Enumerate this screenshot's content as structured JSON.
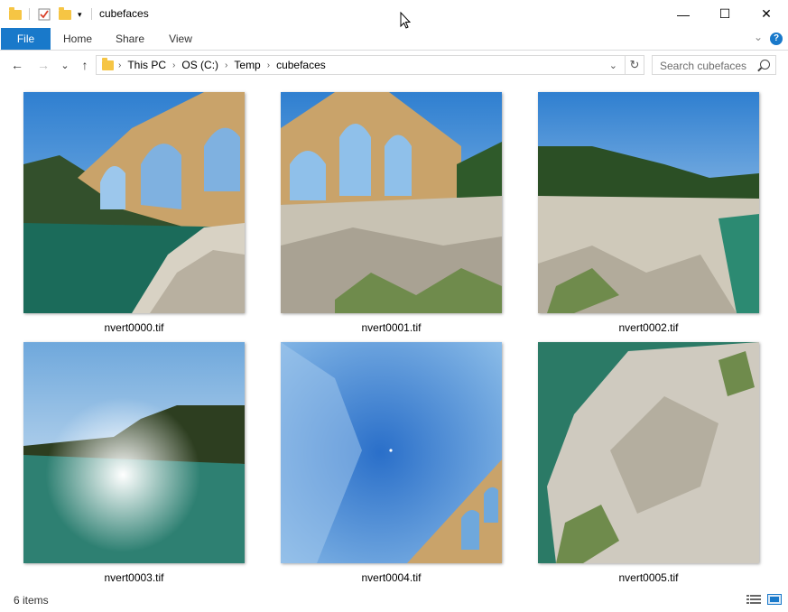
{
  "window": {
    "title": "cubefaces",
    "minimize": "—",
    "maximize": "☐",
    "close": "✕"
  },
  "ribbon": {
    "tabs": [
      "File",
      "Home",
      "Share",
      "View"
    ],
    "help": "?"
  },
  "nav": {
    "back": "←",
    "forward": "→",
    "recent": "⌄",
    "up": "↑",
    "breadcrumb": [
      "This PC",
      "OS (C:)",
      "Temp",
      "cubefaces"
    ],
    "search_placeholder": "Search cubefaces"
  },
  "files": [
    {
      "name": "nvert0000.tif",
      "scene": "aqueduct-river"
    },
    {
      "name": "nvert0001.tif",
      "scene": "aqueduct-rocks"
    },
    {
      "name": "nvert0002.tif",
      "scene": "hills-rocks"
    },
    {
      "name": "nvert0003.tif",
      "scene": "river-sun"
    },
    {
      "name": "nvert0004.tif",
      "scene": "sky-aqueduct-corner"
    },
    {
      "name": "nvert0005.tif",
      "scene": "rock-closeup"
    }
  ],
  "status": {
    "count": "6 items"
  },
  "colors": {
    "accent": "#1979ca",
    "folder": "#f6c544"
  }
}
